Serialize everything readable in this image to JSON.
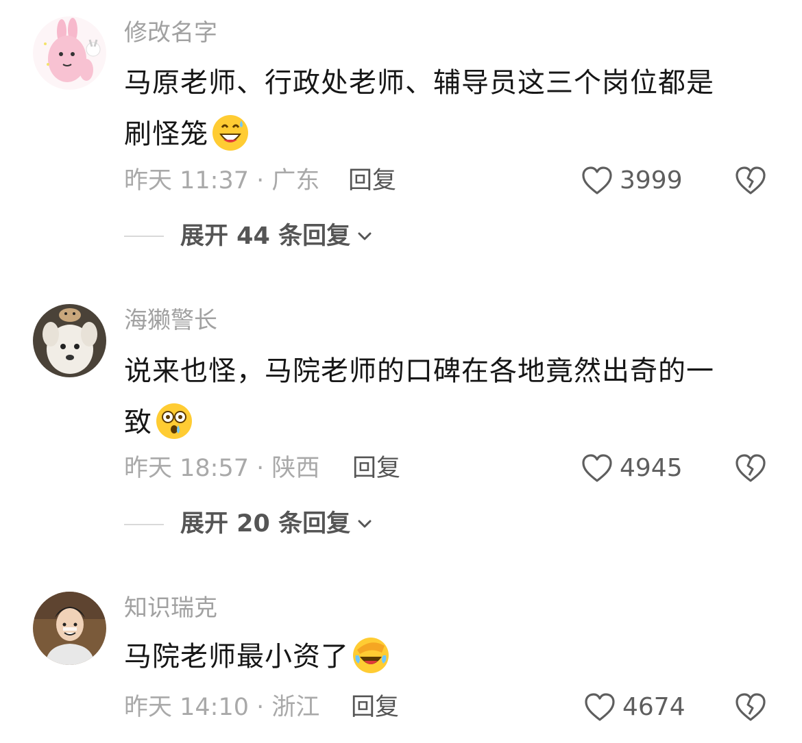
{
  "comments": [
    {
      "username": "修改名字",
      "text_line1": "马原老师、行政处老师、辅导员这三个岗位都是",
      "text_line2": "刷怪笼",
      "emoji": "grinning-sweat-emoji",
      "meta": "昨天 11:37 · 广东",
      "reply_label": "回复",
      "likes": "3999",
      "expand_label": "展开 44 条回复"
    },
    {
      "username": "海獭警长",
      "text_line1": "说来也怪，马院老师的口碑在各地竟然出奇的一",
      "text_line2": "致",
      "emoji": "flushed-tear-emoji",
      "meta": "昨天 18:57 · 陕西",
      "reply_label": "回复",
      "likes": "4945",
      "expand_label": "展开 20 条回复"
    },
    {
      "username": "知识瑞克",
      "text_line1": "马院老师最小资了",
      "emoji": "facepalm-laugh-emoji",
      "meta": "昨天 14:10 · 浙江",
      "reply_label": "回复",
      "likes": "4674"
    }
  ],
  "icons": {
    "like": "heart-outline-icon",
    "dislike": "broken-heart-icon",
    "expand": "chevron-down-icon"
  },
  "colors": {
    "username": "#a1a1a1",
    "body_text": "#161616",
    "meta": "#a9a9a9",
    "action": "#555555"
  }
}
